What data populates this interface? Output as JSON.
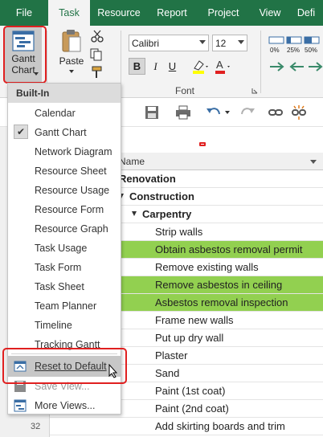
{
  "tabs": [
    "File",
    "Task",
    "Resource",
    "Report",
    "Project",
    "View",
    "Defi"
  ],
  "ribbon": {
    "gantt_line1": "Gantt",
    "gantt_line2": "Chart",
    "paste_label": "Paste",
    "font_name": "Calibri",
    "font_size": "12",
    "font_group_label": "Font",
    "bold_label": "B",
    "italic_label": "I",
    "underline_label": "U",
    "pct_labels": [
      "0%",
      "25%",
      "50%"
    ]
  },
  "menu": {
    "header": "Built-In",
    "items": [
      "Calendar",
      "Gantt Chart",
      "Network Diagram",
      "Resource Sheet",
      "Resource Usage",
      "Resource Form",
      "Resource Graph",
      "Task Usage",
      "Task Form",
      "Task Sheet",
      "Team Planner",
      "Timeline",
      "Tracking Gantt"
    ],
    "reset": "Reset to Default",
    "save_view": "Save View...",
    "more_views": "More Views..."
  },
  "grid": {
    "name_header": "Name",
    "row_number": "32",
    "rows": [
      "Renovation",
      "Construction",
      "Carpentry",
      "Strip walls",
      "Obtain asbestos removal permit",
      "Remove existing walls",
      "Remove asbestos in ceiling",
      "Asbestos removal inspection",
      "Frame new walls",
      "Put up dry wall",
      "Plaster",
      "Sand",
      "Paint (1st coat)",
      "Paint (2nd coat)",
      "Add skirting boards and trim"
    ]
  },
  "colors": {
    "ribbon_green": "#217346",
    "highlight_green": "#92d050",
    "annotation_red": "#e02020"
  }
}
